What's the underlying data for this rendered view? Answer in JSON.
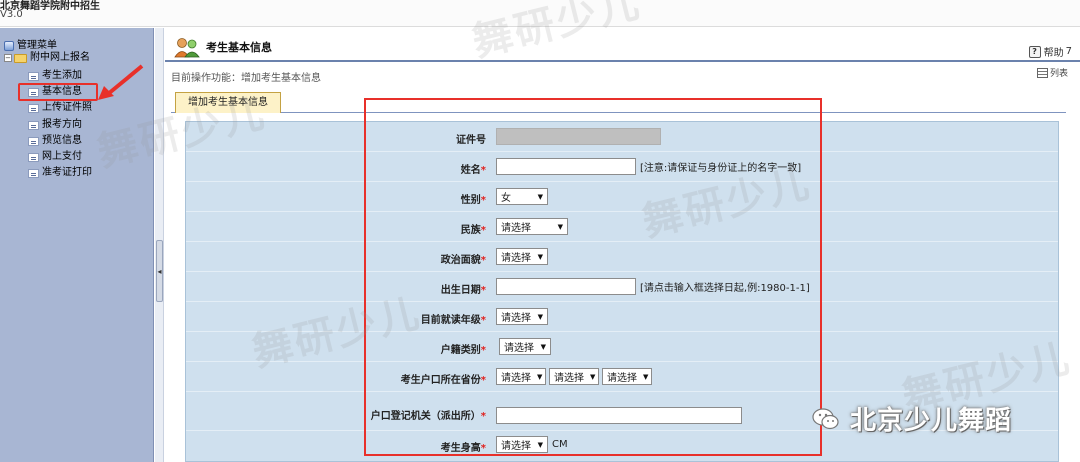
{
  "app": {
    "title": "北京舞蹈学院附中招生",
    "version": "V3.0"
  },
  "sidebar": {
    "root_label": "管理菜单",
    "folder_label": "附中网上报名",
    "items": [
      {
        "label": "考生添加"
      },
      {
        "label": "基本信息"
      },
      {
        "label": "上传证件照"
      },
      {
        "label": "报考方向"
      },
      {
        "label": "预览信息"
      },
      {
        "label": "网上支付"
      },
      {
        "label": "准考证打印"
      }
    ],
    "selected_item": "基本信息"
  },
  "header": {
    "title": "考生基本信息",
    "help_label": "帮助",
    "help_shortcut": "7",
    "breadcrumb": "目前操作功能：增加考生基本信息",
    "list_label": "列表"
  },
  "tabs": [
    {
      "label": "增加考生基本信息",
      "active": true
    }
  ],
  "form": {
    "fields": [
      {
        "label": "证件号",
        "required": false,
        "type": "text",
        "value": "",
        "readonly": true
      },
      {
        "label": "姓名",
        "required": true,
        "type": "text",
        "value": "",
        "hint": "[注意:请保证与身份证上的名字一致]"
      },
      {
        "label": "性别",
        "required": true,
        "type": "select",
        "selected": "女"
      },
      {
        "label": "民族",
        "required": true,
        "type": "select",
        "selected": "请选择"
      },
      {
        "label": "政治面貌",
        "required": true,
        "type": "select",
        "selected": "请选择"
      },
      {
        "label": "出生日期",
        "required": true,
        "type": "text",
        "value": "",
        "hint": "[请点击输入框选择日起,例:1980-1-1]"
      },
      {
        "label": "目前就读年级",
        "required": true,
        "type": "select",
        "selected": "请选择"
      },
      {
        "label": "户籍类别",
        "required": true,
        "type": "select",
        "selected": "请选择"
      },
      {
        "label": "考生户口所在省份",
        "required": true,
        "type": "select3",
        "selected": [
          "请选择",
          "请选择",
          "请选择"
        ]
      },
      {
        "label": "户口登记机关（派出所）",
        "required": true,
        "type": "text",
        "value": ""
      },
      {
        "label": "考生身高",
        "required": true,
        "type": "select",
        "selected": "请选择",
        "unit": "CM"
      }
    ]
  },
  "overlay": {
    "watermark_text": "舞研少儿",
    "wechat_label": "北京少儿舞蹈",
    "highlight_color": "#e8302a"
  }
}
